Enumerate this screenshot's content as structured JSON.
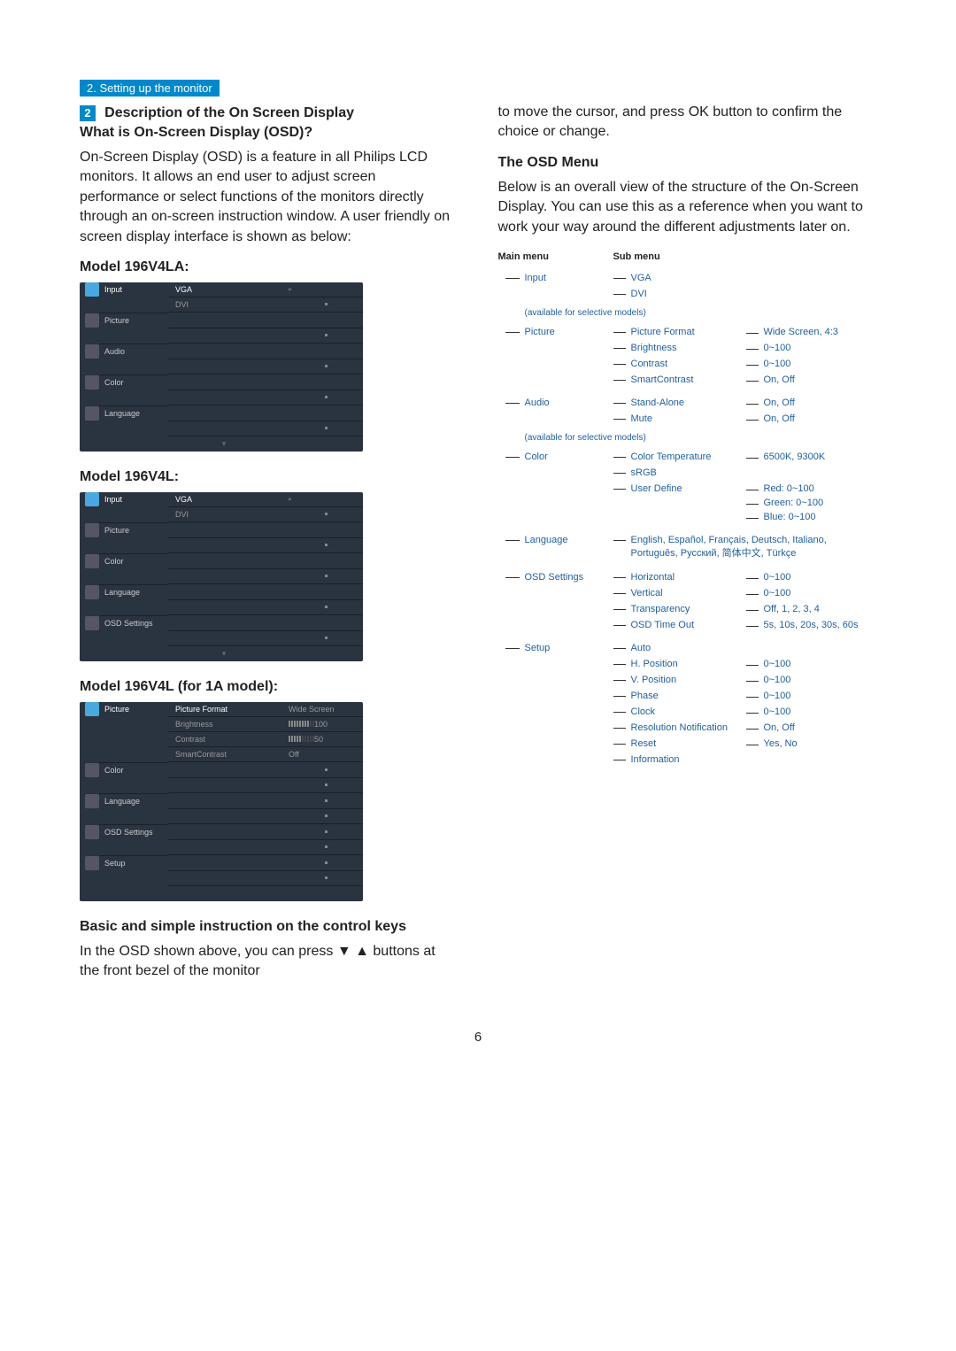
{
  "breadcrumb": "2. Setting up the monitor",
  "section_num": "2",
  "h_desc": "Description of the On Screen Display",
  "h_what": "What is On-Screen Display (OSD)?",
  "p_what": "On-Screen Display (OSD) is a feature in all Philips LCD monitors. It allows an end user to adjust screen performance or select functions of the monitors directly through an on-screen instruction window. A user friendly on screen display interface is shown as below:",
  "h_m1": "Model 196V4LA:",
  "h_m2": "Model 196V4L:",
  "h_m3": "Model 196V4L (for 1A model):",
  "h_basic": "Basic and simple instruction on the control keys",
  "p_basic": "In the OSD shown above, you can press ▼ ▲ buttons at the front bezel of the monitor",
  "p_col2a": "to move the cursor, and press OK button to confirm the choice or change.",
  "h_osdmenu": "The OSD Menu",
  "p_osdmenu": "Below is an overall view of the structure of the On-Screen Display. You can use this as a reference when you want to work your way around the different adjustments later on.",
  "th_main": "Main menu",
  "th_sub": "Sub menu",
  "pagenum": "6",
  "osd1": {
    "items": [
      "Input",
      "Picture",
      "Audio",
      "Color",
      "Language"
    ],
    "sub": [
      "VGA",
      "DVI"
    ]
  },
  "osd2": {
    "items": [
      "Input",
      "Picture",
      "Color",
      "Language",
      "OSD Settings"
    ],
    "sub": [
      "VGA",
      "DVI"
    ]
  },
  "osd3": {
    "items": [
      "Picture",
      "Color",
      "Language",
      "OSD Settings",
      "Setup"
    ],
    "sub": [
      "Picture Format",
      "Brightness",
      "Contrast",
      "SmartContrast"
    ],
    "vals": [
      "Wide Screen",
      "100",
      "50",
      "Off"
    ]
  },
  "tree": {
    "input": {
      "label": "Input",
      "note": "(available for selective models)",
      "subs": [
        {
          "n": "VGA"
        },
        {
          "n": "DVI"
        }
      ]
    },
    "picture": {
      "label": "Picture",
      "subs": [
        {
          "n": "Picture Format",
          "v": "Wide Screen, 4:3"
        },
        {
          "n": "Brightness",
          "v": "0~100"
        },
        {
          "n": "Contrast",
          "v": "0~100"
        },
        {
          "n": "SmartContrast",
          "v": "On, Off"
        }
      ]
    },
    "audio": {
      "label": "Audio",
      "note": "(available for selective models)",
      "subs": [
        {
          "n": "Stand-Alone",
          "v": "On, Off"
        },
        {
          "n": "Mute",
          "v": "On, Off"
        }
      ]
    },
    "color": {
      "label": "Color",
      "subs": [
        {
          "n": "Color Temperature",
          "v": "6500K, 9300K"
        },
        {
          "n": "sRGB"
        },
        {
          "n": "User Define",
          "vals": [
            "Red: 0~100",
            "Green: 0~100",
            "Blue: 0~100"
          ]
        }
      ]
    },
    "language": {
      "label": "Language",
      "text": "English, Español, Français, Deutsch, Italiano, Português, Русский, 简体中文, Türkçe"
    },
    "osdsettings": {
      "label": "OSD Settings",
      "subs": [
        {
          "n": "Horizontal",
          "v": "0~100"
        },
        {
          "n": "Vertical",
          "v": "0~100"
        },
        {
          "n": "Transparency",
          "v": "Off, 1, 2, 3, 4"
        },
        {
          "n": "OSD Time Out",
          "v": "5s, 10s, 20s, 30s, 60s"
        }
      ]
    },
    "setup": {
      "label": "Setup",
      "subs": [
        {
          "n": "Auto"
        },
        {
          "n": "H. Position",
          "v": "0~100"
        },
        {
          "n": "V. Position",
          "v": "0~100"
        },
        {
          "n": "Phase",
          "v": "0~100"
        },
        {
          "n": "Clock",
          "v": "0~100"
        },
        {
          "n": "Resolution Notification",
          "v": "On, Off"
        },
        {
          "n": "Reset",
          "v": "Yes, No"
        },
        {
          "n": "Information"
        }
      ]
    }
  }
}
